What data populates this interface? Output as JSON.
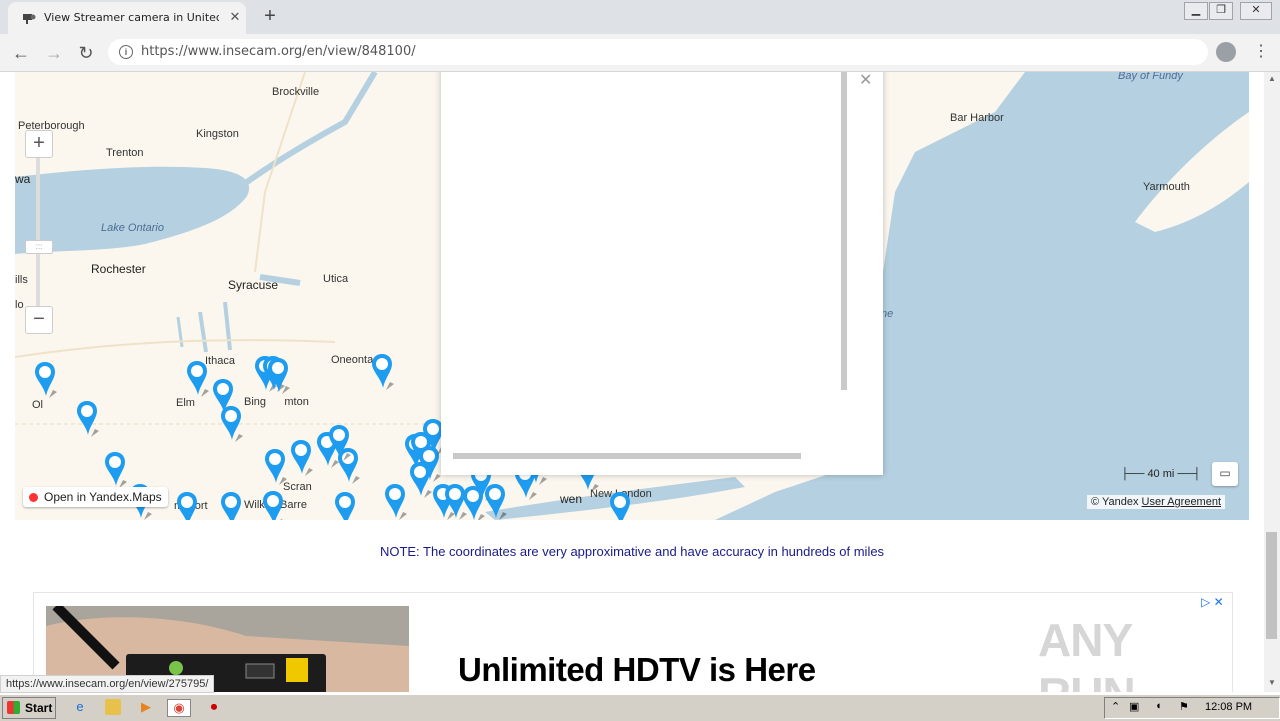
{
  "browser": {
    "tab_title": "View Streamer camera in United Stat",
    "tab_close": "✕",
    "new_tab": "+",
    "url": "https://www.insecam.org/en/view/848100/",
    "status_url": "https://www.insecam.org/en/view/275795/"
  },
  "map": {
    "labels": {
      "peterborough": "Peterborough",
      "brockville": "Brockville",
      "kingston": "Kingston",
      "trenton": "Trenton",
      "wa": "wa",
      "lake_ontario": "Lake Ontario",
      "rochester": "Rochester",
      "syracuse": "Syracuse",
      "utica": "Utica",
      "ills": "ills",
      "lo": "lo",
      "ithaca": "Ithaca",
      "oneonta": "Oneonta",
      "olean": "Ol",
      "elmira": "Elm",
      "binghamton": "Bing      mton",
      "scranton": "Scran",
      "wilkes_barre": "Wilkes-Barre",
      "williamsport": "msport",
      "new_haven": "wen",
      "new_london": "New London",
      "bay_of_fundy": "Bay of Fundy",
      "bar_harbor": "Bar Harbor",
      "yarmouth": "Yarmouth",
      "gulf_fragment": "ne"
    },
    "zoom_in": "+",
    "zoom_out": "−",
    "zoom_handle": ":::",
    "open_in_yandex": "Open in Yandex.Maps",
    "scale": "40 mi",
    "copyright": "© Yandex",
    "user_agreement": "User Agreement"
  },
  "note": "NOTE: The coordinates are very approximative and have accuracy in hundreds of miles",
  "ad": {
    "headline": "Unlimited HDTV is Here",
    "watermark": "ANY RUN"
  },
  "taskbar": {
    "start_label": "Start",
    "clock": "12:08 PM"
  },
  "colors": {
    "water": "#b5d0e0",
    "land": "#fbf7ee",
    "pin": "#1e9cf0",
    "note_text": "#1a1a8a"
  }
}
